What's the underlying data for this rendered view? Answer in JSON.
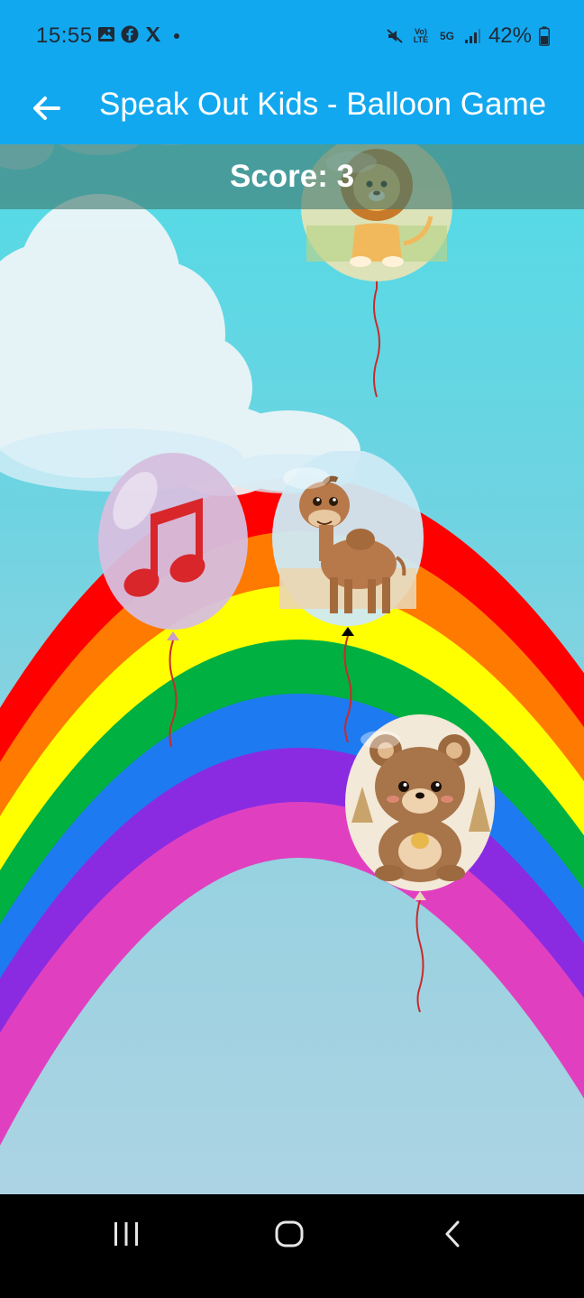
{
  "status_bar": {
    "time": "15:55",
    "left_icons": [
      "gallery-icon",
      "facebook-icon",
      "x-icon",
      "dot-icon"
    ],
    "right_icons": [
      "mute-icon",
      "volte-icon",
      "5g-icon",
      "signal-icon",
      "battery-icon"
    ],
    "volte_text": "Vo) LTE",
    "net_text": "5G",
    "battery": "42%"
  },
  "app_bar": {
    "title": "Speak Out Kids - Balloon Game",
    "back_icon": "arrow-left-icon",
    "background": "#12a8ef"
  },
  "game": {
    "score_text": "Score: 3",
    "score": 3,
    "balloons": [
      {
        "name": "lion-balloon",
        "content": "lion"
      },
      {
        "name": "music-balloon",
        "content": "music note"
      },
      {
        "name": "camel-balloon",
        "content": "camel"
      },
      {
        "name": "bear-balloon",
        "content": "bear"
      }
    ],
    "colors": {
      "rainbow": [
        "#ff0000",
        "#ff7a00",
        "#ffff00",
        "#00b040",
        "#1e7af0",
        "#8a2be2",
        "#e040c0"
      ],
      "note": "#d8262b"
    }
  },
  "nav_bar": {
    "buttons": [
      "recent-apps-icon",
      "home-icon",
      "back-icon"
    ]
  }
}
